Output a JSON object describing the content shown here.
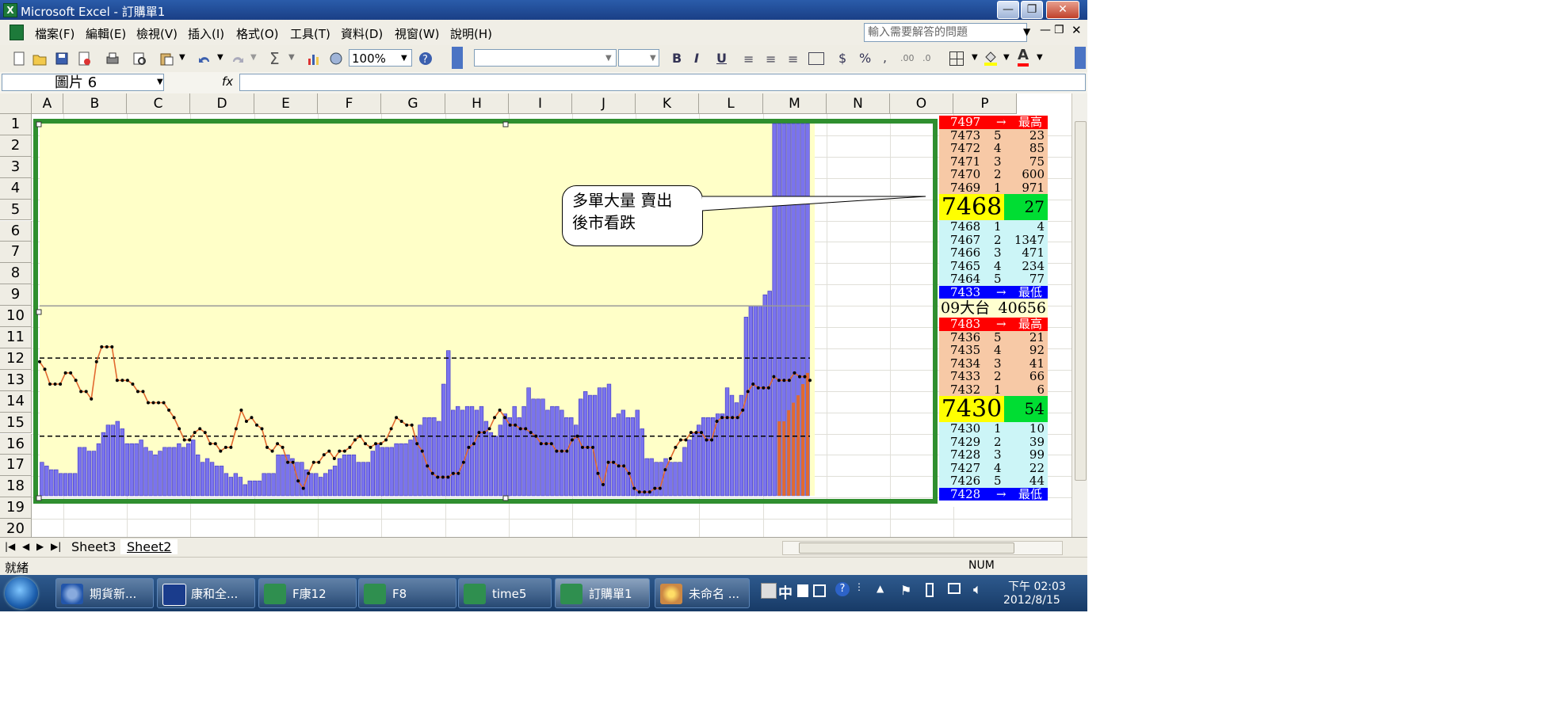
{
  "window": {
    "title": "Microsoft Excel - 訂購單1",
    "minimize": "—",
    "restore": "❐",
    "close": "✕"
  },
  "menus": [
    "檔案(F)",
    "編輯(E)",
    "檢視(V)",
    "插入(I)",
    "格式(O)",
    "工具(T)",
    "資料(D)",
    "視窗(W)",
    "說明(H)"
  ],
  "help_placeholder": "輸入需要解答的問題",
  "toolbar": {
    "zoom": "100%",
    "bold": "B",
    "italic": "I",
    "underline": "U",
    "currency": "$",
    "percent": "%"
  },
  "formula_bar": {
    "name_box": "圖片 6",
    "fx": "fx"
  },
  "columns": [
    "A",
    "B",
    "C",
    "D",
    "E",
    "F",
    "G",
    "H",
    "I",
    "J",
    "K",
    "L",
    "M",
    "N",
    "O",
    "P"
  ],
  "rows": [
    "1",
    "2",
    "3",
    "4",
    "5",
    "6",
    "7",
    "8",
    "9",
    "10",
    "11",
    "12",
    "13",
    "14",
    "15",
    "16",
    "17",
    "18",
    "19",
    "20"
  ],
  "callout": {
    "line1": "多單大量 賣出",
    "line2": "後市看跌"
  },
  "chart_data": {
    "type": "bar",
    "ylim": [
      0,
      100
    ],
    "series": [
      {
        "kind": "bar",
        "values": [
          9,
          8,
          7,
          7,
          6,
          6,
          6,
          6,
          13,
          13,
          12,
          12,
          14,
          17,
          19,
          19,
          20,
          18,
          14,
          14,
          14,
          15,
          13,
          12,
          11,
          12,
          13,
          13,
          13,
          14,
          13,
          14,
          15,
          11,
          9,
          10,
          9,
          8,
          8,
          6,
          5,
          6,
          5,
          3,
          4,
          4,
          4,
          6,
          6,
          6,
          11,
          11,
          11,
          10,
          9,
          9,
          7,
          6,
          6,
          5,
          6,
          7,
          8,
          10,
          11,
          11,
          11,
          9,
          9,
          9,
          12,
          14,
          13,
          13,
          13,
          14,
          14,
          14,
          15,
          16,
          19,
          21,
          21,
          21,
          20,
          30,
          39,
          23,
          24,
          23,
          24,
          24,
          23,
          24,
          20,
          17,
          16,
          19,
          22,
          21,
          24,
          21,
          24,
          29,
          26,
          26,
          26,
          23,
          24,
          24,
          23,
          21,
          21,
          19,
          26,
          28,
          27,
          27,
          29,
          29,
          30,
          21,
          22,
          23,
          21,
          21,
          23,
          18,
          10,
          10,
          9,
          9,
          10,
          9,
          9,
          9,
          13,
          15,
          17,
          19,
          21,
          21,
          21,
          22,
          22,
          29,
          27,
          25,
          27,
          48,
          51,
          51,
          51,
          54,
          55,
          100,
          100,
          100,
          100,
          100,
          100,
          100,
          100
        ]
      },
      {
        "kind": "bar-orange",
        "values": [
          0,
          0,
          0,
          0,
          0,
          0,
          0,
          0,
          0,
          0,
          0,
          0,
          0,
          0,
          0,
          0,
          0,
          0,
          0,
          0,
          0,
          0,
          0,
          0,
          0,
          0,
          0,
          0,
          0,
          0,
          0,
          0,
          0,
          0,
          0,
          0,
          0,
          0,
          0,
          0,
          0,
          0,
          0,
          0,
          0,
          0,
          0,
          0,
          0,
          0,
          0,
          0,
          0,
          0,
          0,
          0,
          0,
          0,
          0,
          0,
          0,
          0,
          0,
          0,
          0,
          0,
          0,
          0,
          0,
          0,
          0,
          0,
          0,
          0,
          0,
          0,
          0,
          0,
          0,
          0,
          0,
          0,
          0,
          0,
          0,
          0,
          0,
          0,
          0,
          0,
          0,
          0,
          0,
          0,
          0,
          0,
          0,
          0,
          0,
          0,
          0,
          0,
          0,
          0,
          0,
          0,
          0,
          0,
          0,
          0,
          0,
          0,
          0,
          0,
          0,
          0,
          0,
          0,
          0,
          0,
          0,
          0,
          0,
          0,
          0,
          0,
          0,
          0,
          0,
          0,
          0,
          0,
          0,
          0,
          0,
          0,
          0,
          0,
          0,
          0,
          0,
          0,
          0,
          0,
          0,
          0,
          0,
          0,
          0,
          0,
          0,
          0,
          0,
          0,
          0,
          0,
          20,
          20,
          23,
          25,
          27,
          30,
          33
        ]
      },
      {
        "kind": "line",
        "values": [
          36,
          34,
          30,
          30,
          30,
          33,
          33,
          31,
          28,
          28,
          26,
          36,
          40,
          40,
          40,
          31,
          31,
          31,
          30,
          28,
          28,
          25,
          25,
          25,
          25,
          23,
          21,
          18,
          15,
          15,
          17,
          18,
          17,
          14,
          14,
          12,
          13,
          13,
          18,
          23,
          20,
          21,
          19,
          18,
          13,
          12,
          14,
          13,
          9,
          9,
          4,
          2,
          6,
          9,
          9,
          11,
          12,
          10,
          12,
          12,
          13,
          15,
          16,
          14,
          13,
          14,
          14,
          15,
          18,
          21,
          20,
          19,
          19,
          14,
          12,
          8,
          6,
          5,
          5,
          5,
          6,
          6,
          9,
          13,
          14,
          17,
          17,
          18,
          21,
          23,
          21,
          19,
          19,
          18,
          18,
          17,
          16,
          14,
          14,
          14,
          12,
          12,
          12,
          15,
          16,
          13,
          13,
          13,
          6,
          3,
          9,
          9,
          8,
          8,
          6,
          2,
          1,
          1,
          1,
          2,
          2,
          7,
          10,
          13,
          15,
          15,
          17,
          17,
          17,
          15,
          15,
          20,
          21,
          21,
          21,
          21,
          23,
          28,
          30,
          29,
          29,
          29,
          32,
          31,
          31,
          31,
          33,
          32,
          32,
          31
        ]
      }
    ],
    "hlines": [
      37,
      16,
      51
    ]
  },
  "orderbook": {
    "ask_high": {
      "price": "7497",
      "arrow": "→",
      "label": "最高"
    },
    "asks": [
      {
        "price": "7473",
        "level": "5",
        "qty": "23"
      },
      {
        "price": "7472",
        "level": "4",
        "qty": "85"
      },
      {
        "price": "7471",
        "level": "3",
        "qty": "75"
      },
      {
        "price": "7470",
        "level": "2",
        "qty": "600"
      },
      {
        "price": "7469",
        "level": "1",
        "qty": "971"
      }
    ],
    "last1": {
      "price": "7468",
      "qty": "27"
    },
    "bids": [
      {
        "price": "7468",
        "level": "1",
        "qty": "4"
      },
      {
        "price": "7467",
        "level": "2",
        "qty": "1347"
      },
      {
        "price": "7466",
        "level": "3",
        "qty": "471"
      },
      {
        "price": "7465",
        "level": "4",
        "qty": "234"
      },
      {
        "price": "7464",
        "level": "5",
        "qty": "77"
      }
    ],
    "low1": {
      "price": "7433",
      "arrow": "→",
      "label": "最低"
    },
    "product": {
      "name": "09大台",
      "volume": "40656"
    },
    "ask_high2": {
      "price": "7483",
      "arrow": "→",
      "label": "最高"
    },
    "asks2": [
      {
        "price": "7436",
        "level": "5",
        "qty": "21"
      },
      {
        "price": "7435",
        "level": "4",
        "qty": "92"
      },
      {
        "price": "7434",
        "level": "3",
        "qty": "41"
      },
      {
        "price": "7433",
        "level": "2",
        "qty": "66"
      },
      {
        "price": "7432",
        "level": "1",
        "qty": "6"
      }
    ],
    "last2": {
      "price": "7430",
      "qty": "54"
    },
    "bids2": [
      {
        "price": "7430",
        "level": "1",
        "qty": "10"
      },
      {
        "price": "7429",
        "level": "2",
        "qty": "39"
      },
      {
        "price": "7428",
        "level": "3",
        "qty": "99"
      },
      {
        "price": "7427",
        "level": "4",
        "qty": "22"
      },
      {
        "price": "7426",
        "level": "5",
        "qty": "44"
      }
    ],
    "low2": {
      "price": "7428",
      "arrow": "→",
      "label": "最低"
    }
  },
  "sheets": [
    "Sheet3",
    "Sheet2"
  ],
  "status": {
    "ready": "就緒",
    "num": "NUM"
  },
  "taskbar": {
    "items": [
      "期貨新...",
      "康和全...",
      "F康12",
      "F8",
      "time5",
      "訂購單1",
      "未命名 ..."
    ],
    "tray_ime": "中",
    "time": "下午 02:03",
    "date": "2012/8/15"
  },
  "colors": {
    "chart_bg": "#ffffc8",
    "bar": "#7a73ee",
    "bar_orange": "#e2692f",
    "line": "#e2692f",
    "frame": "#2f8f2f",
    "ask_bg": "#f7c9a6",
    "bid_bg": "#ccf5f7",
    "high_bg": "#ff0000",
    "low_bg": "#0000ff",
    "last_bg": "#ffff00",
    "last_qty_bg": "#00dd33"
  }
}
